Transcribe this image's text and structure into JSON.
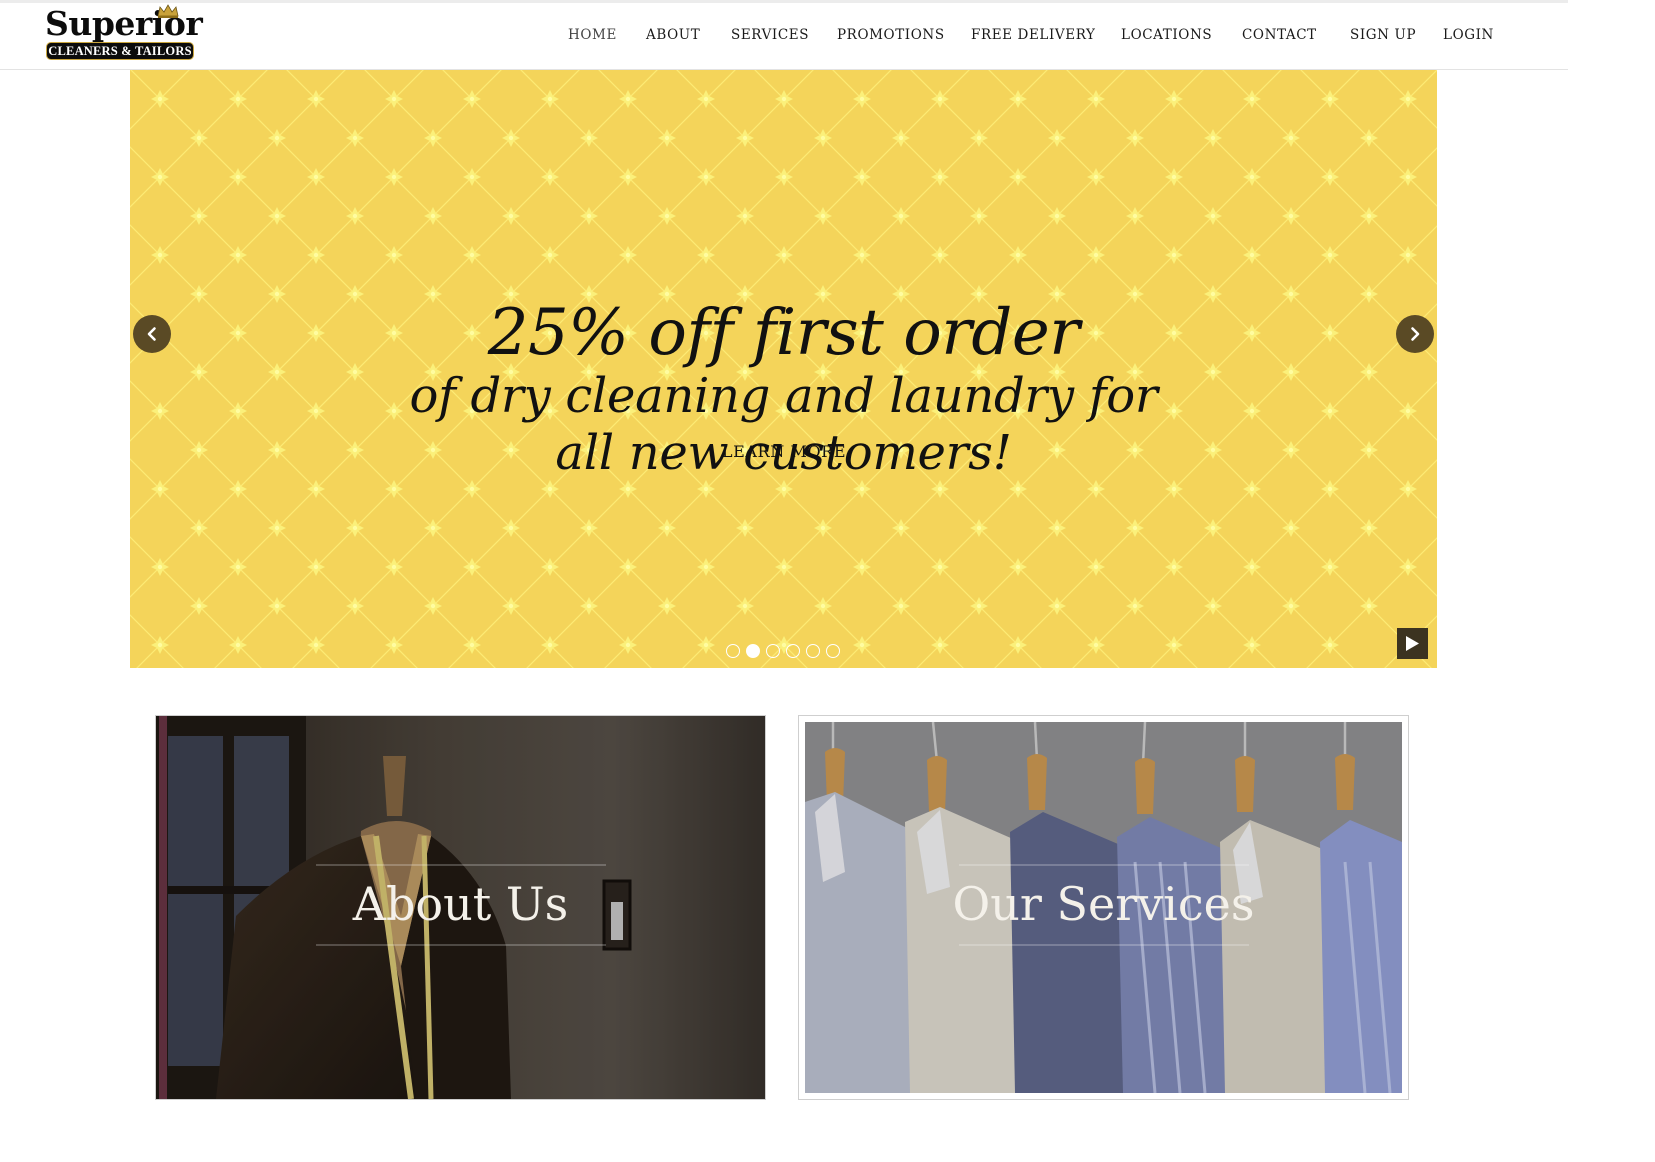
{
  "brand": {
    "name": "Superior",
    "tagline": "CLEANERS & TAILORS",
    "accent": "#f4d45a",
    "dark": "#0c0c0c"
  },
  "nav": {
    "items": [
      {
        "label": "HOME",
        "active": true
      },
      {
        "label": "ABOUT",
        "active": false
      },
      {
        "label": "SERVICES",
        "active": false
      },
      {
        "label": "PROMOTIONS",
        "active": false
      },
      {
        "label": "FREE DELIVERY",
        "active": false
      },
      {
        "label": "LOCATIONS",
        "active": false
      },
      {
        "label": "CONTACT",
        "active": false
      },
      {
        "label": "SIGN UP",
        "active": false
      },
      {
        "label": "LOGIN",
        "active": false
      }
    ]
  },
  "hero": {
    "headline": "25% off first order",
    "subline_1": "of dry cleaning and laundry for",
    "subline_2": "all new customers!",
    "cta": "LEARN MORE",
    "slide_count": 6,
    "active_slide": 2,
    "prev_icon": "chevron-left-icon",
    "next_icon": "chevron-right-icon",
    "play_icon": "play-icon",
    "background_color": "#f4d45a"
  },
  "cards": [
    {
      "title": "About Us",
      "image": "tailor mannequin with suit jacket"
    },
    {
      "title": "Our Services",
      "image": "row of shirts on wooden hangers"
    }
  ]
}
